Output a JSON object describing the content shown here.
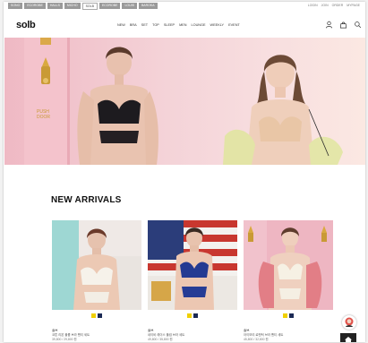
{
  "brand_tabs": [
    {
      "label": "SONO",
      "active": false
    },
    {
      "label": "ECOROBE",
      "active": false
    },
    {
      "label": "HALLS",
      "active": false
    },
    {
      "label": "MICHO",
      "active": false
    },
    {
      "label": "SOLB",
      "active": true
    },
    {
      "label": "ECOROBE",
      "active": false
    },
    {
      "label": "LOUIS",
      "active": false
    },
    {
      "label": "BAROKA",
      "active": false
    }
  ],
  "top_links": [
    "LOGIN",
    "JOIN",
    "ORDER",
    "MYPAGE"
  ],
  "header": {
    "logo": "solb",
    "nav": [
      "NEW",
      "BRA",
      "SET",
      "TOP",
      "SLEEP",
      "MEN",
      "LOUNGE",
      "WEEKLY",
      "EVENT"
    ],
    "icons": [
      "user-icon",
      "bag-icon",
      "search-icon"
    ]
  },
  "section": {
    "title": "NEW ARRIVALS"
  },
  "products": [
    {
      "name": "솔브",
      "desc": "코튼 리본 볼륨 브라 팬티 세트",
      "price": "39,800 / 29,800 원",
      "swatches": [
        "#f0d000",
        "#1b2a55"
      ]
    },
    {
      "name": "솔브",
      "desc": "네이비 레이스 풀컵 브라 세트",
      "price": "49,800 / 35,800 원",
      "swatches": [
        "#f0d000",
        "#1b2a55"
      ]
    },
    {
      "name": "솔브",
      "desc": "아이보리 로맨틱 브라 팬티 세트",
      "price": "45,800 / 32,800 원",
      "swatches": [
        "#f0d000",
        "#1b2a55"
      ]
    }
  ],
  "colors": {
    "hero_bg": "#f3cfd5",
    "accent": "#111111"
  }
}
